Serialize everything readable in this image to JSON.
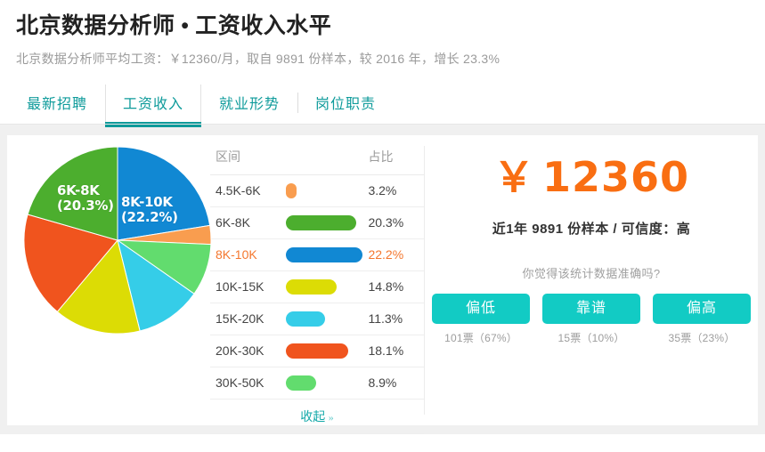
{
  "header": {
    "title": "北京数据分析师 • 工资收入水平",
    "subtitle": "北京数据分析师平均工资：￥12360/月，取自 9891 份样本，较 2016 年，增长 23.3%"
  },
  "tabs": [
    {
      "label": "最新招聘",
      "active": false
    },
    {
      "label": "工资收入",
      "active": true
    },
    {
      "label": "就业形势",
      "active": false
    },
    {
      "label": "岗位职责",
      "active": false
    }
  ],
  "table": {
    "header_range": "区间",
    "header_pct": "占比",
    "more_label": "收起",
    "more_chevron": "»",
    "rows": [
      {
        "range": "4.5K-6K",
        "pct": "3.2%",
        "value": 3.2,
        "color": "#f99d4f",
        "highlight": false
      },
      {
        "range": "6K-8K",
        "pct": "20.3%",
        "value": 20.3,
        "color": "#4cae2e",
        "highlight": false
      },
      {
        "range": "8K-10K",
        "pct": "22.2%",
        "value": 22.2,
        "color": "#1188d3",
        "highlight": true
      },
      {
        "range": "10K-15K",
        "pct": "14.8%",
        "value": 14.8,
        "color": "#dcdc05",
        "highlight": false
      },
      {
        "range": "15K-20K",
        "pct": "11.3%",
        "value": 11.3,
        "color": "#35cde8",
        "highlight": false
      },
      {
        "range": "20K-30K",
        "pct": "18.1%",
        "value": 18.1,
        "color": "#f0541e",
        "highlight": false
      },
      {
        "range": "30K-50K",
        "pct": "8.9%",
        "value": 8.9,
        "color": "#62dc6e",
        "highlight": false
      }
    ]
  },
  "pie_labels": [
    {
      "text": "6K-8K\n(20.3%)",
      "line1": "6K-8K",
      "line2": "(20.3%)"
    },
    {
      "text": "8K-10K\n(22.2%)",
      "line1": "8K-10K",
      "line2": "(22.2%)"
    }
  ],
  "summary": {
    "currency": "￥",
    "amount": "12360",
    "sample_line": "近1年 9891 份样本 / 可信度：高",
    "vote_question": "你觉得该统计数据准确吗?",
    "votes": [
      {
        "label": "偏低",
        "count": "101票（67%）"
      },
      {
        "label": "靠谱",
        "count": "15票（10%）"
      },
      {
        "label": "偏高",
        "count": "35票（23%）"
      }
    ]
  },
  "colors": {
    "accent_teal": "#0f9b9b",
    "accent_orange": "#f96e12",
    "button_teal": "#12cbc4"
  },
  "chart_data": {
    "type": "pie",
    "title": "北京数据分析师工资收入分布",
    "categories": [
      "4.5K-6K",
      "6K-8K",
      "8K-10K",
      "10K-15K",
      "15K-20K",
      "20K-30K",
      "30K-50K"
    ],
    "values": [
      3.2,
      20.3,
      22.2,
      14.8,
      11.3,
      18.1,
      8.9
    ],
    "unit": "%",
    "colors": [
      "#f99d4f",
      "#4cae2e",
      "#1188d3",
      "#dcdc05",
      "#35cde8",
      "#f0541e",
      "#62dc6e"
    ],
    "start_angle_deg": 0,
    "direction": "clockwise",
    "slice_order": [
      "8K-10K",
      "4.5K-6K",
      "30K-50K",
      "15K-20K",
      "10K-15K",
      "20K-30K",
      "6K-8K"
    ],
    "labels_shown": [
      "6K-8K (20.3%)",
      "8K-10K (22.2%)"
    ],
    "legend": "table",
    "grid": false
  }
}
